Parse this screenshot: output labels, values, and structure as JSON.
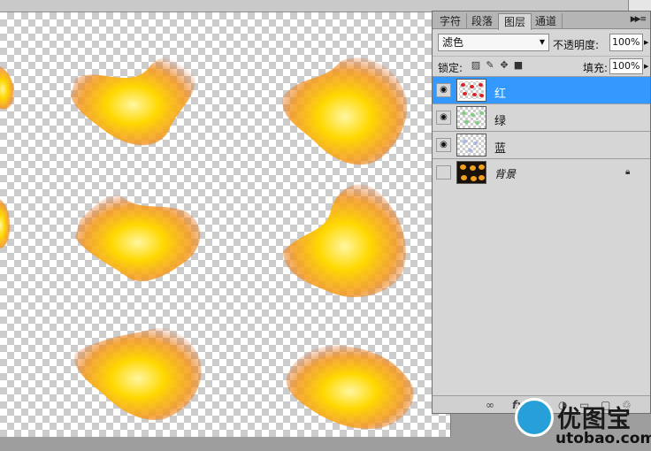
{
  "panel": {
    "tabs": [
      "字符",
      "段落",
      "图层",
      "通道"
    ],
    "active_tab": "图层",
    "menu_icon": "panel-menu-icon"
  },
  "blend": {
    "mode": "滤色",
    "opacity_label": "不透明度:",
    "opacity_value": "100%"
  },
  "lock": {
    "label": "锁定:",
    "fill_label": "填充:",
    "fill_value": "100%"
  },
  "layers": [
    {
      "name": "红",
      "visible": true,
      "selected": true
    },
    {
      "name": "绿",
      "visible": true,
      "selected": false
    },
    {
      "name": "蓝",
      "visible": true,
      "selected": false
    },
    {
      "name": "背景",
      "visible": false,
      "selected": false,
      "locked": true
    }
  ],
  "footer_icons": [
    "link-icon",
    "fx-icon",
    "mask-icon",
    "adjustment-icon",
    "group-icon",
    "new-layer-icon",
    "trash-icon"
  ],
  "watermark": {
    "title": "优图宝",
    "url": "utobao.com"
  },
  "colors": {
    "selection": "#3399ff",
    "panel_bg": "#d6d6d6",
    "fire_core": "#ffe000",
    "fire_edge": "#e8701a"
  }
}
